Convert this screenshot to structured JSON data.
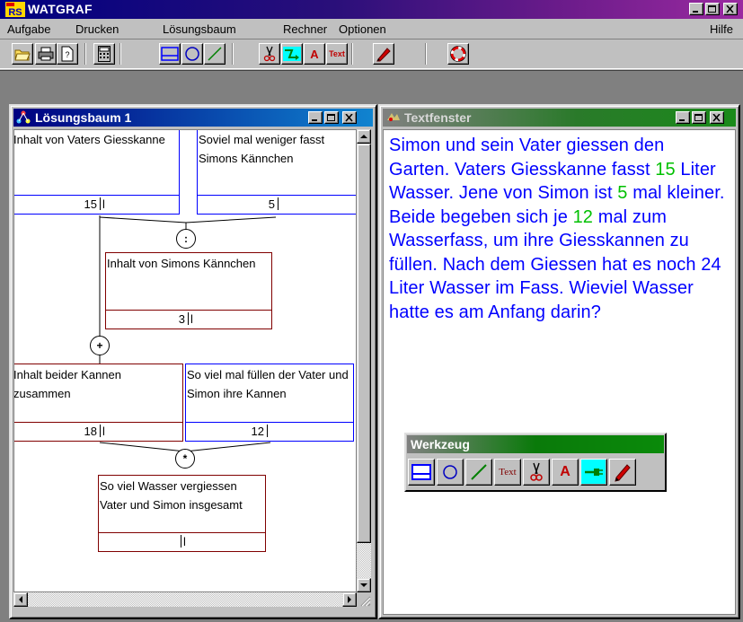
{
  "app": {
    "title": "WATGRAF",
    "logo_text": "RS"
  },
  "menu": {
    "items": [
      {
        "label": "Aufgabe"
      },
      {
        "label": "Drucken"
      },
      {
        "label": "Lösungsbaum"
      },
      {
        "label": "Rechner"
      },
      {
        "label": "Optionen"
      }
    ],
    "help": "Hilfe"
  },
  "toolbar": {
    "icons": [
      "open-folder-icon",
      "printer-icon",
      "page-icon",
      "calculator-icon",
      "box-tool-icon",
      "circle-tool-icon",
      "line-tool-icon",
      "scissors-icon",
      "connector-icon",
      "font-icon",
      "text-tool-icon",
      "pencil-icon",
      "lifebuoy-icon"
    ],
    "text_tool_label": "Text",
    "font_label": "A"
  },
  "tree_window": {
    "title": "Lösungsbaum 1",
    "boxes": [
      {
        "text": "Inhalt von Vaters Giesskanne",
        "value": "15",
        "unit": "l"
      },
      {
        "text": "Soviel mal weniger fasst Simons Kännchen",
        "value": "5",
        "unit": ""
      },
      {
        "text": "Inhalt von Simons Kännchen",
        "value": "3",
        "unit": "l"
      },
      {
        "text": "Inhalt beider Kannen zusammen",
        "value": "18",
        "unit": "l"
      },
      {
        "text": "So viel mal füllen der Vater und Simon ihre Kannen",
        "value": "12",
        "unit": ""
      },
      {
        "text": "So viel Wasser vergiessen Vater und Simon insgesamt",
        "value": "",
        "unit": "l"
      }
    ],
    "operators": [
      ":",
      "+",
      "*"
    ]
  },
  "text_window": {
    "title": "Textfenster",
    "segments": [
      {
        "text": "Simon und sein Vater giessen den Garten. Vaters Giesskanne fasst ",
        "hl": false
      },
      {
        "text": "15",
        "hl": true
      },
      {
        "text": " Liter Wasser. Jene von Simon ist ",
        "hl": false
      },
      {
        "text": "5",
        "hl": true
      },
      {
        "text": " mal kleiner. Beide begeben sich je ",
        "hl": false
      },
      {
        "text": "12",
        "hl": true
      },
      {
        "text": " mal zum Wasserfass, um ihre Giesskannen zu füllen. Nach dem Giessen hat es noch 24 Liter Wasser im Fass. Wieviel Wasser hatte es am Anfang darin?",
        "hl": false
      }
    ]
  },
  "palette": {
    "title": "Werkzeug",
    "text_tool_label": "Text",
    "font_label": "A"
  },
  "colors": {
    "question_box": "#0000ff",
    "result_box": "#800000",
    "text": "#0000ff",
    "highlight": "#00c000"
  }
}
